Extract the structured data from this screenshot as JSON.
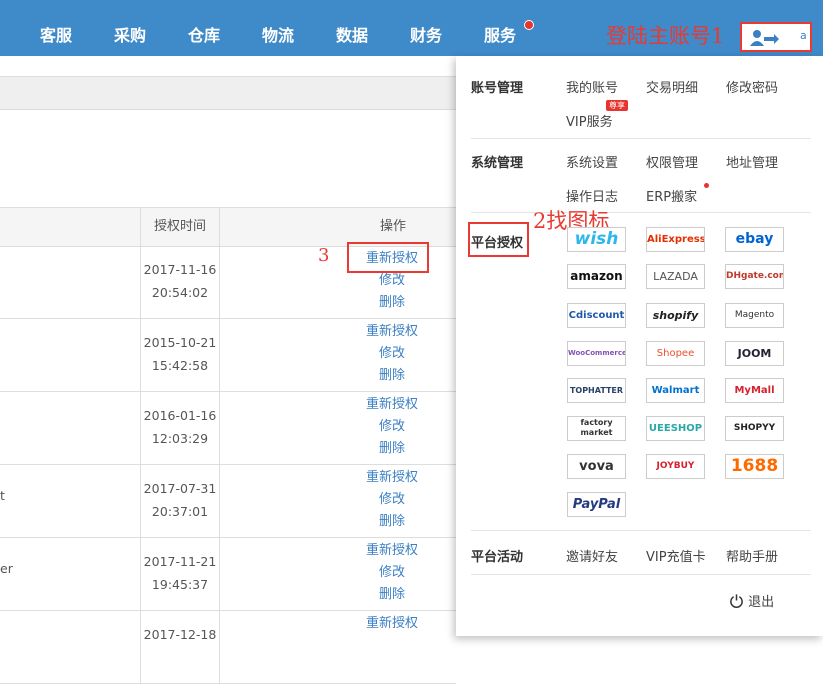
{
  "nav": {
    "items": [
      "客服",
      "采购",
      "仓库",
      "物流",
      "数据",
      "财务",
      "服务"
    ]
  },
  "annotations": {
    "step1": "登陆主账号1",
    "step2": "2找图标",
    "step3": "3"
  },
  "user": {
    "name": "a"
  },
  "table": {
    "headers": {
      "time": "授权时间",
      "ops": "操作"
    },
    "ops_labels": {
      "reauth": "重新授权",
      "edit": "修改",
      "delete": "删除"
    },
    "rows": [
      {
        "name": "",
        "date": "2017-11-16",
        "time": "20:54:02"
      },
      {
        "name": "",
        "date": "2015-10-21",
        "time": "15:42:58"
      },
      {
        "name": "",
        "date": "2016-01-16",
        "time": "12:03:29"
      },
      {
        "name": "t",
        "date": "2017-07-31",
        "time": "20:37:01"
      },
      {
        "name": "er",
        "date": "2017-11-21",
        "time": "19:45:37"
      },
      {
        "name": "",
        "date": "2017-12-18",
        "time": ""
      }
    ]
  },
  "menu": {
    "account": {
      "title": "账号管理",
      "my_account": "我的账号",
      "transactions": "交易明细",
      "change_password": "修改密码",
      "vip": "VIP服务",
      "vip_badge": "尊享"
    },
    "system": {
      "title": "系统管理",
      "settings": "系统设置",
      "permissions": "权限管理",
      "address": "地址管理",
      "log": "操作日志",
      "erp": "ERP搬家"
    },
    "platform": {
      "title": "平台授权",
      "logos": [
        "wish",
        "AliExpress",
        "ebay",
        "amazon",
        "LAZADA",
        "DHgate.com",
        "Cdiscount",
        "shopify",
        "Magento",
        "WooCommerce",
        "Shopee",
        "JOOM",
        "TOPHATTER",
        "Walmart",
        "MyMall",
        "factory market",
        "UEESHOP",
        "SHOPYY",
        "vova",
        "JOYBUY",
        "1688",
        "PayPal"
      ]
    },
    "activity": {
      "title": "平台活动",
      "invite": "邀请好友",
      "vip_recharge": "VIP充值卡",
      "help": "帮助手册"
    },
    "logout": "退出"
  },
  "colors": {
    "topbar": "#3f8ac9",
    "annotation": "#e83a32",
    "link": "#3b7fc4"
  }
}
